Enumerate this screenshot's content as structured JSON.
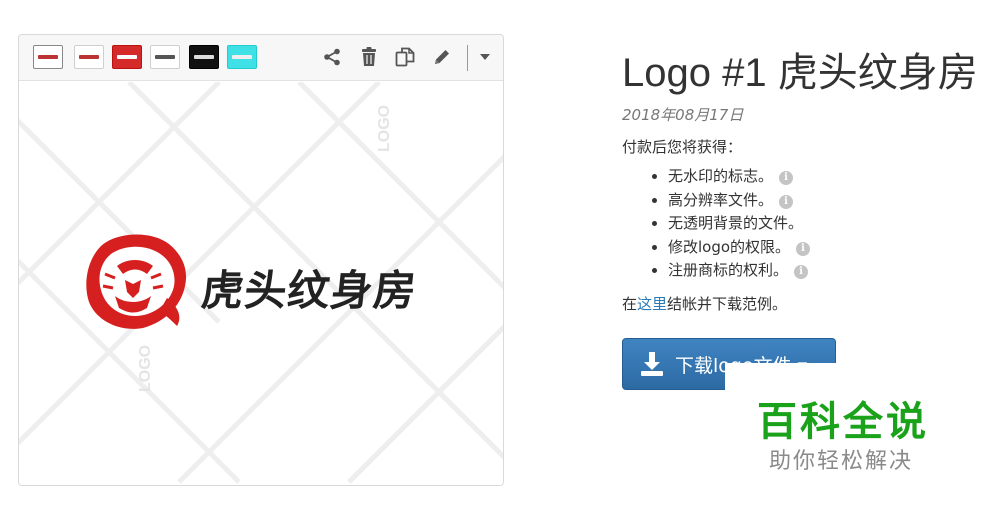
{
  "preview": {
    "swatches": [
      {
        "name": "white-outline",
        "bg": "#ffffff",
        "mini": "#b33"
      },
      {
        "name": "white",
        "bg": "#ffffff",
        "mini": "#b33"
      },
      {
        "name": "red",
        "bg": "#d42a2a",
        "mini": "#ffffff"
      },
      {
        "name": "white-2",
        "bg": "#ffffff",
        "mini": "#555"
      },
      {
        "name": "black",
        "bg": "#111111",
        "mini": "#ddd"
      },
      {
        "name": "cyan",
        "bg": "#3fe0e6",
        "mini": "#eee"
      }
    ],
    "tools": [
      "share-icon",
      "trash-icon",
      "copy-icon",
      "pencil-icon",
      "caret-down-icon"
    ],
    "logo_name": "虎头纹身房",
    "logo_color": "#d61f1f",
    "watermark_text": "LOGO"
  },
  "info": {
    "title": "Logo #1 虎头纹身房",
    "date": "2018年08月17日",
    "intro": "付款后您将获得：",
    "benefits": [
      {
        "text": "无水印的标志。",
        "info": true
      },
      {
        "text": "高分辨率文件。",
        "info": true
      },
      {
        "text": "无透明背景的文件。",
        "info": false
      },
      {
        "text": "修改logo的权限。",
        "info": true
      },
      {
        "text": "注册商标的权利。",
        "info": true
      }
    ],
    "checkout_prefix": "在",
    "checkout_link": "这里",
    "checkout_suffix": "结帐并下载范例。",
    "download_label": "下载logo文件 ▾"
  },
  "watermark": {
    "main": "百科全说",
    "sub": "助你轻松解决",
    "main_color": "#1aa21a"
  },
  "colors": {
    "accent": "#2d6aa3",
    "link": "#2a7ab8"
  }
}
